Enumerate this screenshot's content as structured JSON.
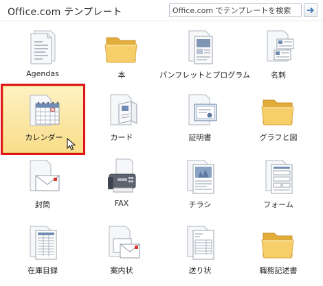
{
  "header": {
    "title": "Office.com テンプレート",
    "search_placeholder": "Office.com でテンプレートを検索",
    "search_value": ""
  },
  "categories": [
    {
      "label": "Agendas",
      "icon": "document-stack-icon",
      "selected": false
    },
    {
      "label": "本",
      "icon": "folder-icon",
      "selected": false
    },
    {
      "label": "パンフレットとプログラム",
      "icon": "brochure-icon",
      "selected": false
    },
    {
      "label": "名刺",
      "icon": "business-card-icon",
      "selected": false
    },
    {
      "label": "カレンダー",
      "icon": "calendar-icon",
      "selected": true
    },
    {
      "label": "カード",
      "icon": "greeting-card-icon",
      "selected": false
    },
    {
      "label": "証明書",
      "icon": "certificate-icon",
      "selected": false
    },
    {
      "label": "グラフと図",
      "icon": "folder-icon",
      "selected": false
    },
    {
      "label": "封筒",
      "icon": "envelope-icon",
      "selected": false
    },
    {
      "label": "FAX",
      "icon": "fax-icon",
      "selected": false
    },
    {
      "label": "チラシ",
      "icon": "flyer-icon",
      "selected": false
    },
    {
      "label": "フォーム",
      "icon": "form-icon",
      "selected": false
    },
    {
      "label": "在庫目録",
      "icon": "inventory-icon",
      "selected": false
    },
    {
      "label": "案内状",
      "icon": "invitation-icon",
      "selected": false
    },
    {
      "label": "送り状",
      "icon": "invoice-icon",
      "selected": false
    },
    {
      "label": "職務記述書",
      "icon": "folder-icon",
      "selected": false
    }
  ],
  "colors": {
    "selection_fill": "#f9dd8a",
    "highlight_border": "#e0151b",
    "folder": "#f2c457"
  }
}
